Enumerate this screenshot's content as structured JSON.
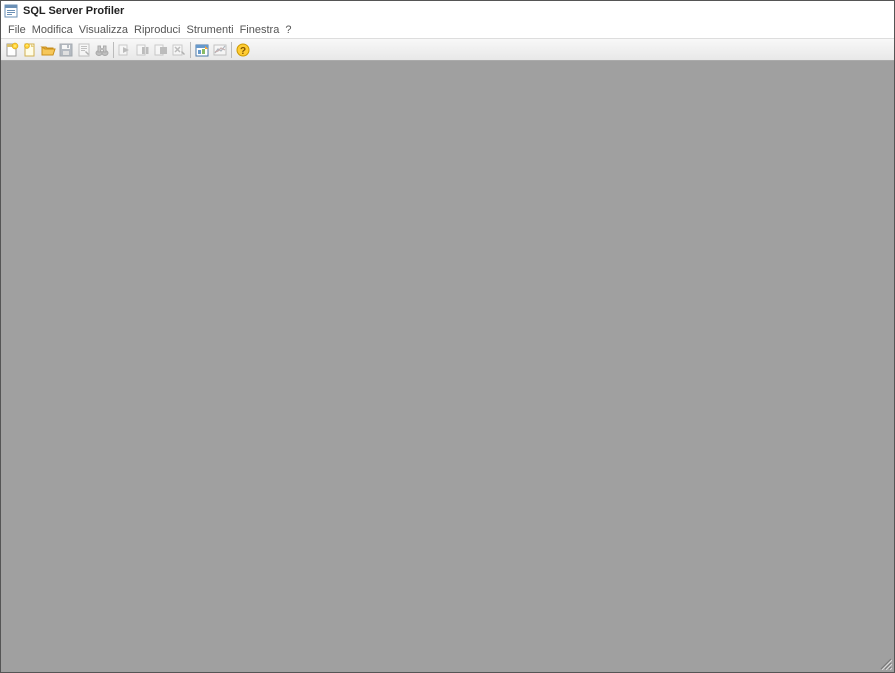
{
  "app": {
    "title": "SQL Server Profiler"
  },
  "menu": {
    "file": "File",
    "edit": "Modifica",
    "view": "Visualizza",
    "replay": "Riproduci",
    "tools": "Strumenti",
    "window": "Finestra",
    "help": "?"
  },
  "toolbar": {
    "new_trace": "Nuova traccia",
    "new_template": "Nuovo modello",
    "open": "Apri",
    "save": "Salva",
    "properties": "Proprietà",
    "find": "Trova",
    "start": "Avvia",
    "pause": "Pausa",
    "stop": "Arresta",
    "clear": "Cancella",
    "tuning": "Ottimizzazione guidata",
    "perfmon": "Importa dati prestazioni",
    "help_btn": "?"
  }
}
